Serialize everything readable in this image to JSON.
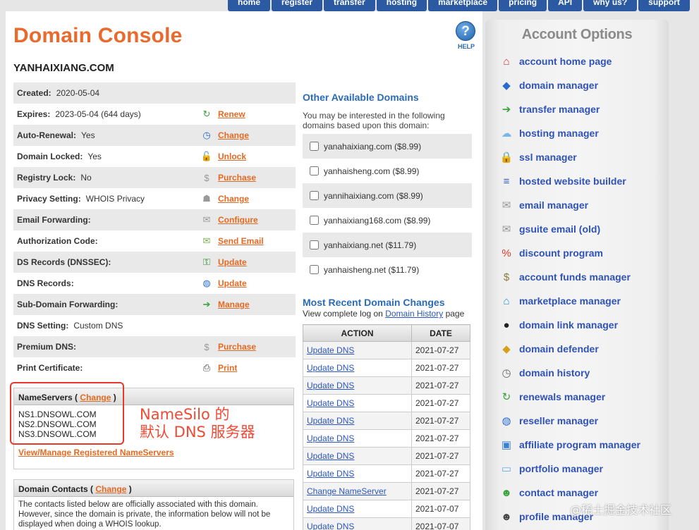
{
  "topnav": [
    "home",
    "register",
    "transfer",
    "hosting",
    "marketplace",
    "pricing",
    "API",
    "why us?",
    "support"
  ],
  "title": "Domain Console",
  "help_label": "HELP",
  "help_glyph": "?",
  "domain": "YANHAIXIANG.COM",
  "info_rows": [
    {
      "label": "Created:",
      "value": "2020-05-04",
      "action": "",
      "icon": ""
    },
    {
      "label": "Expires:",
      "value": "2023-05-04 (644 days)",
      "action": "Renew",
      "icon": "renew-icon"
    },
    {
      "label": "Auto-Renewal:",
      "value": "Yes",
      "action": "Change",
      "icon": "clock-icon"
    },
    {
      "label": "Domain Locked:",
      "value": "Yes",
      "action": "Unlock",
      "icon": "lock-icon"
    },
    {
      "label": "Registry Lock:",
      "value": "No",
      "action": "Purchase",
      "icon": "dollar-icon"
    },
    {
      "label": "Privacy Setting:",
      "value": "WHOIS Privacy",
      "action": "Change",
      "icon": "privacy-icon"
    },
    {
      "label": "Email Forwarding:",
      "value": "",
      "action": "Configure",
      "icon": "envelope-icon"
    },
    {
      "label": "Authorization Code:",
      "value": "",
      "action": "Send Email",
      "icon": "mail-code-icon"
    },
    {
      "label": "DS Records (DNSSEC):",
      "value": "",
      "action": "Update",
      "icon": "key-icon"
    },
    {
      "label": "DNS Records:",
      "value": "",
      "action": "Update",
      "icon": "globe-icon"
    },
    {
      "label": "Sub-Domain Forwarding:",
      "value": "",
      "action": "Manage",
      "icon": "arrow-right-icon"
    },
    {
      "label": "DNS Setting:",
      "value": "Custom DNS",
      "action": "",
      "icon": ""
    },
    {
      "label": "Premium DNS:",
      "value": "",
      "action": "Purchase",
      "icon": "dollar-icon"
    },
    {
      "label": "Print Certificate:",
      "value": "",
      "action": "Print",
      "icon": "printer-icon"
    }
  ],
  "nameservers": {
    "header": "NameServers (",
    "change": "Change",
    "close": ")",
    "list": [
      "NS1.DNSOWL.COM",
      "NS2.DNSOWL.COM",
      "NS3.DNSOWL.COM"
    ],
    "manage_link": "View/Manage Registered NameServers"
  },
  "annotation": {
    "line1": "NameSilo 的",
    "line2": "默认 DNS 服务器"
  },
  "contacts": {
    "header": "Domain Contacts (",
    "change": "Change",
    "close": ")",
    "text": "The contacts listed below are officially associated with this domain. However, since the domain is private, the information below will not be displayed when doing a WHOIS lookup."
  },
  "other": {
    "title": "Other Available Domains",
    "intro": "You may be interested in the following domains based upon this domain:",
    "items": [
      "yanahaixiang.com ($8.99)",
      "yanhaisheng.com ($8.99)",
      "yannihaixiang.com ($8.99)",
      "yanhaixiang168.com ($8.99)",
      "yanhaixiang.net ($11.79)",
      "yanhaisheng.net ($11.79)"
    ]
  },
  "recent": {
    "title": "Most Recent Domain Changes",
    "sub_prefix": "View complete log on",
    "sub_link": "Domain History",
    "sub_suffix": "page",
    "col_action": "ACTION",
    "col_date": "DATE",
    "rows": [
      {
        "action": "Update DNS",
        "date": "2021-07-27"
      },
      {
        "action": "Update DNS",
        "date": "2021-07-27"
      },
      {
        "action": "Update DNS",
        "date": "2021-07-27"
      },
      {
        "action": "Update DNS",
        "date": "2021-07-27"
      },
      {
        "action": "Update DNS",
        "date": "2021-07-27"
      },
      {
        "action": "Update DNS",
        "date": "2021-07-27"
      },
      {
        "action": "Update DNS",
        "date": "2021-07-27"
      },
      {
        "action": "Update DNS",
        "date": "2021-07-27"
      },
      {
        "action": "Change NameServer",
        "date": "2021-07-27"
      },
      {
        "action": "Update DNS",
        "date": "2021-07-07"
      },
      {
        "action": "Update DNS",
        "date": "2021-07-07"
      }
    ]
  },
  "account": {
    "title": "Account Options",
    "items": [
      {
        "label": "account home page",
        "icon": "home-icon",
        "glyph": "⌂",
        "color": "#c0392b"
      },
      {
        "label": "domain manager",
        "icon": "domain-manager-icon",
        "glyph": "◆",
        "color": "#2a6bd0"
      },
      {
        "label": "transfer manager",
        "icon": "transfer-arrow-icon",
        "glyph": "➔",
        "color": "#3aa23a"
      },
      {
        "label": "hosting manager",
        "icon": "cloud-icon",
        "glyph": "☁",
        "color": "#7ab6e8"
      },
      {
        "label": "ssl manager",
        "icon": "padlock-icon",
        "glyph": "🔒",
        "color": "#d4a017"
      },
      {
        "label": "hosted website builder",
        "icon": "website-builder-icon",
        "glyph": "≡",
        "color": "#3b5fc9"
      },
      {
        "label": "email manager",
        "icon": "envelope-icon",
        "glyph": "✉",
        "color": "#999999"
      },
      {
        "label": "gsuite email (old)",
        "icon": "envelope-icon",
        "glyph": "✉",
        "color": "#999999"
      },
      {
        "label": "discount program",
        "icon": "ticket-icon",
        "glyph": "%",
        "color": "#e03a2a"
      },
      {
        "label": "account funds manager",
        "icon": "money-bag-icon",
        "glyph": "$",
        "color": "#8a7a3a"
      },
      {
        "label": "marketplace manager",
        "icon": "marketplace-icon",
        "glyph": "⌂",
        "color": "#2a8fd0"
      },
      {
        "label": "domain link manager",
        "icon": "link-icon",
        "glyph": "●",
        "color": "#222222"
      },
      {
        "label": "domain defender",
        "icon": "shield-icon",
        "glyph": "◆",
        "color": "#d4a017"
      },
      {
        "label": "domain history",
        "icon": "history-clock-icon",
        "glyph": "◷",
        "color": "#666666"
      },
      {
        "label": "renewals manager",
        "icon": "renew-icon",
        "glyph": "↻",
        "color": "#3aa23a"
      },
      {
        "label": "reseller manager",
        "icon": "globe-icon",
        "glyph": "◍",
        "color": "#2a6bd0"
      },
      {
        "label": "affiliate program manager",
        "icon": "monitor-icon",
        "glyph": "▣",
        "color": "#3b7fd0"
      },
      {
        "label": "portfolio manager",
        "icon": "folder-icon",
        "glyph": "▭",
        "color": "#6aaee0"
      },
      {
        "label": "contact manager",
        "icon": "contacts-icon",
        "glyph": "☻",
        "color": "#3aa23a"
      },
      {
        "label": "profile manager",
        "icon": "profile-icon",
        "glyph": "☻",
        "color": "#444444"
      }
    ]
  },
  "watermark": "@稀土掘金技术社区"
}
